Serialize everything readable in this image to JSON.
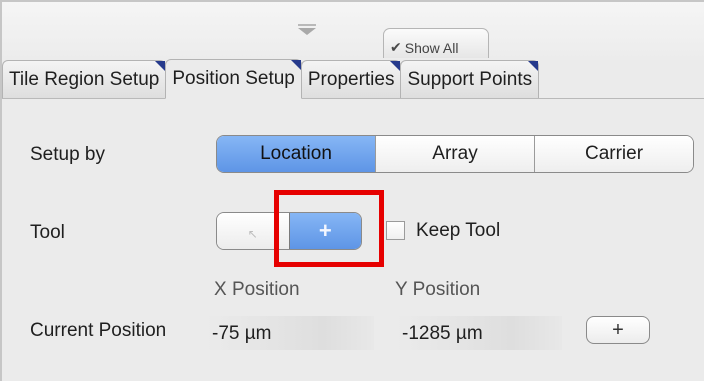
{
  "show_all": {
    "check_icon": "checkmark-icon",
    "label": "Show All"
  },
  "tabs": [
    {
      "label": "Tile Region Setup",
      "active": false
    },
    {
      "label": "Position Setup",
      "active": true
    },
    {
      "label": "Properties",
      "active": false
    },
    {
      "label": "Support Points",
      "active": false
    }
  ],
  "setup_by": {
    "label": "Setup by",
    "options": [
      "Location",
      "Array",
      "Carrier"
    ],
    "selected": "Location"
  },
  "tool": {
    "label": "Tool",
    "buttons": [
      {
        "icon": "pointer-icon",
        "glyph": "↖",
        "selected": false
      },
      {
        "icon": "plus-icon",
        "glyph": "+",
        "selected": true
      }
    ],
    "keep_tool_label": "Keep Tool",
    "keep_tool_checked": false
  },
  "position": {
    "x_header": "X Position",
    "y_header": "Y Position",
    "current_label": "Current Position",
    "x_value": "-75 µm",
    "y_value": "-1285 µm",
    "add_button_glyph": "+"
  },
  "colors": {
    "accent": "#6fa3ee",
    "highlight": "#e60000",
    "tab_corner": "#263a8c"
  }
}
